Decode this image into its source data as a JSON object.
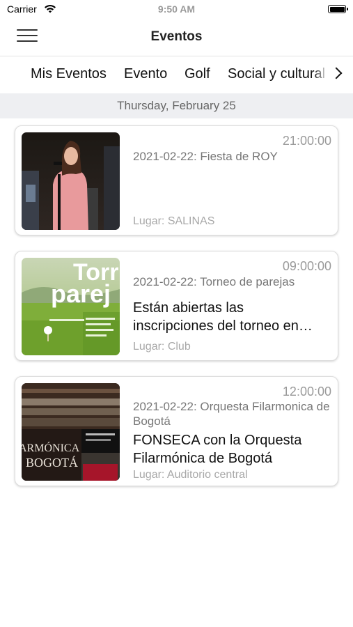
{
  "status_bar": {
    "carrier": "Carrier",
    "time": "9:50 AM"
  },
  "header": {
    "title": "Eventos"
  },
  "tabs": [
    {
      "label": "Mis Eventos"
    },
    {
      "label": "Evento"
    },
    {
      "label": "Golf"
    },
    {
      "label": "Social y cultural"
    }
  ],
  "date_header": "Thursday, February 25",
  "events": [
    {
      "time": "21:00:00",
      "subtitle": "2021-02-22: Fiesta de ROY",
      "description": "",
      "place": "Lugar: SALINAS"
    },
    {
      "time": "09:00:00",
      "subtitle": "2021-02-22: Torneo de parejas",
      "description": "Están abiertas las inscripciones del torneo en…",
      "place": "Lugar: Club",
      "thumb_text": {
        "big1": "Torr",
        "big2": "parej"
      }
    },
    {
      "time": "12:00:00",
      "subtitle": "2021-02-22: Orquesta Filarmonica de Bogotá",
      "description": "FONSECA con la Orquesta Filarmónica de Bogotá",
      "place": "Lugar: Auditorio central",
      "thumb_text": {
        "line1": "ARMÓNICA",
        "line2": "BOGOTÁ"
      }
    }
  ],
  "colors": {
    "date_header_bg": "#eeeff2",
    "muted_text": "#9a9a9a"
  }
}
